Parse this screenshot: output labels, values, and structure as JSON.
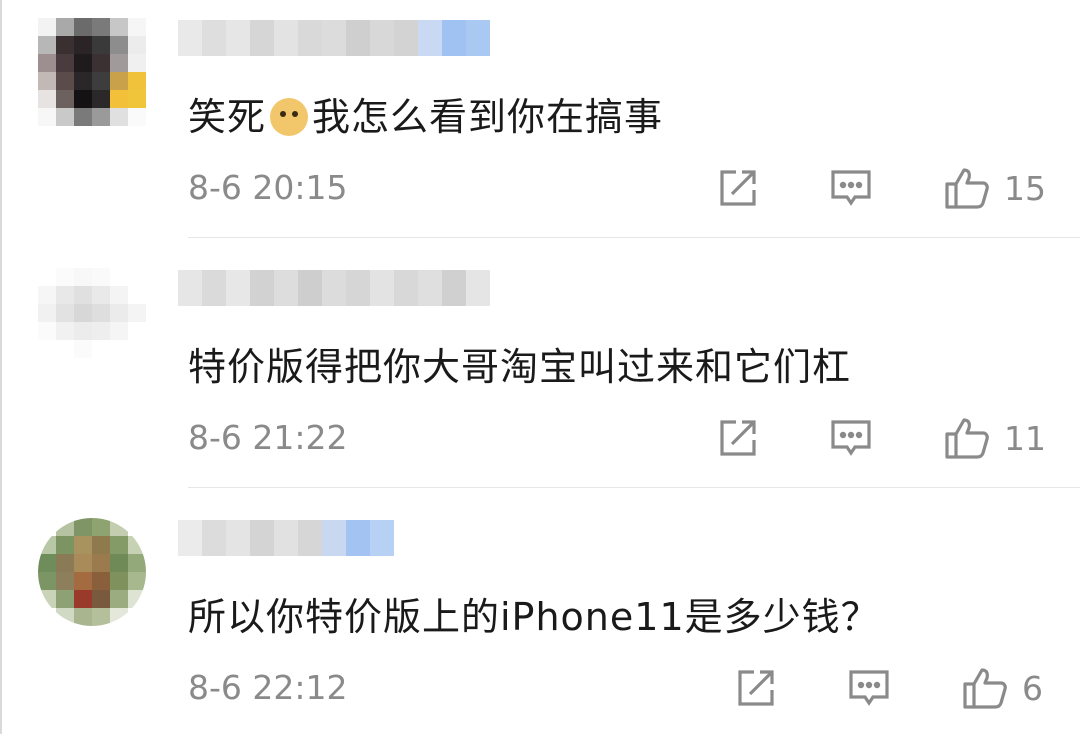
{
  "comments": [
    {
      "text_before_emoji": "笑死",
      "emoji": "doge-emoji",
      "text_after_emoji": "我怎么看到你在搞事",
      "time": "8-6 20:15",
      "likes": "15"
    },
    {
      "text": "特价版得把你大哥淘宝叫过来和它们杠",
      "time": "8-6 21:22",
      "likes": "11"
    },
    {
      "text": "所以你特价版上的iPhone11是多少钱？",
      "time": "8-6 22:12",
      "likes": "6"
    }
  ],
  "icons": {
    "share": "share-icon",
    "reply": "comment-icon",
    "like": "thumbs-up-icon"
  },
  "colors": {
    "text": "#1a1a1a",
    "meta": "#8a8a8a",
    "divider": "#e6e6e6"
  }
}
